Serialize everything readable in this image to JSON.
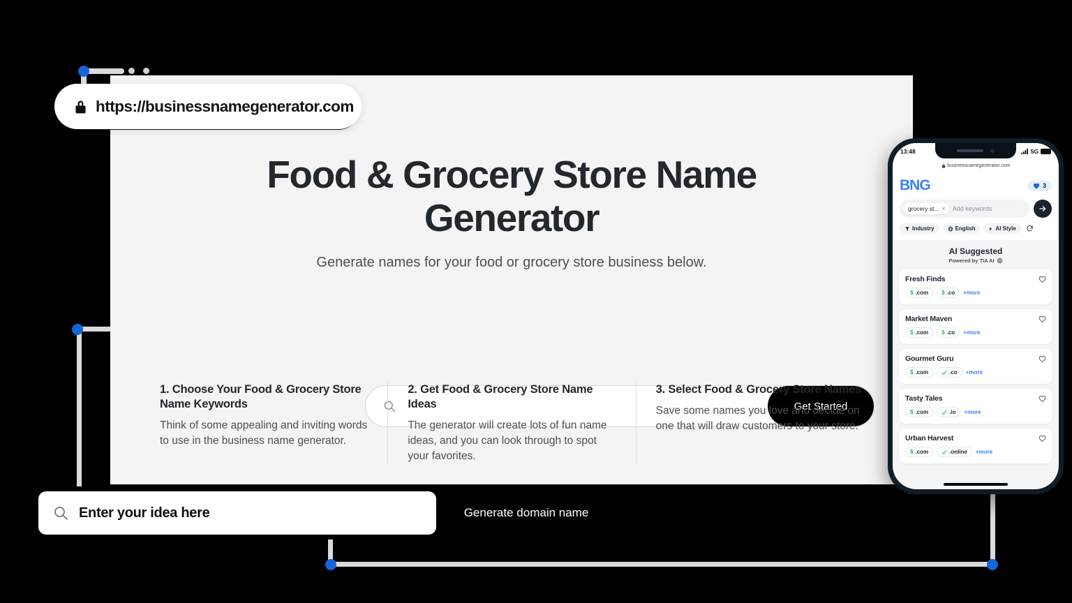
{
  "browser": {
    "url": "https://businessnamegenerator.com",
    "lock_icon": "lock-icon",
    "hero_title": "Food & Grocery Store Name Generator",
    "hero_subtitle": "Generate names for your food or grocery store business below.",
    "search": {
      "placeholder": "",
      "value": "",
      "icon": "search-icon",
      "button_label": "Get Started"
    },
    "steps": [
      {
        "title": "1. Choose Your Food & Grocery Store Name Keywords",
        "body": "Think of some appealing and inviting words to use in the business name generator."
      },
      {
        "title": "2. Get Food & Grocery Store Name Ideas",
        "body": "The generator will create lots of fun name ideas, and you can look through to spot your favorites."
      },
      {
        "title": "3. Select Food & Grocery Store Names",
        "body": "Save some names you love and decide on one that will draw customers to your store."
      }
    ]
  },
  "bottom_bar": {
    "icon": "search-icon",
    "input_value": "Enter your idea here",
    "placeholder": "Enter your idea here",
    "button_label": "Generate domain name"
  },
  "phone": {
    "status": {
      "time": "13:48",
      "network": "5G",
      "signal_icon": "signal-bars-icon",
      "battery_icon": "battery-icon"
    },
    "url_strip": {
      "lock_icon": "lock-icon",
      "domain": "businessnamegenerator.com"
    },
    "app": {
      "logo": "BNG",
      "favorites": {
        "icon": "heart-icon",
        "count": "3"
      },
      "keyword_chip": "grocery st...",
      "keyword_chip_remove": "×",
      "keyword_placeholder": "Add keywords",
      "submit_icon": "arrow-right-icon",
      "filters": [
        {
          "label": "Industry",
          "icon": "funnel-icon"
        },
        {
          "label": "English",
          "icon": "globe-icon"
        },
        {
          "label": "AI Style",
          "icon": "bolt-icon"
        }
      ],
      "refresh_icon": "refresh-icon",
      "suggested_title": "AI Suggested",
      "suggested_subtitle": "Powered by TIA AI",
      "suggested_subtitle_icon": "chip-icon",
      "results": [
        {
          "name": "Fresh Finds",
          "tlds": [
            {
              "label": ".com",
              "state": "paid"
            },
            {
              "label": ".co",
              "state": "paid"
            }
          ],
          "more": "+more",
          "fav_icon": "heart-outline-icon"
        },
        {
          "name": "Market Maven",
          "tlds": [
            {
              "label": ".com",
              "state": "paid"
            },
            {
              "label": ".co",
              "state": "paid"
            }
          ],
          "more": "+more",
          "fav_icon": "heart-outline-icon"
        },
        {
          "name": "Gourmet Guru",
          "tlds": [
            {
              "label": ".com",
              "state": "paid"
            },
            {
              "label": ".co",
              "state": "available"
            }
          ],
          "more": "+more",
          "fav_icon": "heart-outline-icon"
        },
        {
          "name": "Tasty Tales",
          "tlds": [
            {
              "label": ".com",
              "state": "paid"
            },
            {
              "label": ".io",
              "state": "available"
            }
          ],
          "more": "+more",
          "fav_icon": "heart-outline-icon"
        },
        {
          "name": "Urban Harvest",
          "tlds": [
            {
              "label": ".com",
              "state": "paid"
            },
            {
              "label": ".online",
              "state": "available"
            }
          ],
          "more": "+more",
          "fav_icon": "heart-outline-icon"
        }
      ]
    }
  },
  "colors": {
    "accent_blue": "#1565d8",
    "brand_blue": "#3c82f6",
    "available_green": "#22c55e",
    "page_bg": "#f3f4f3",
    "dark": "#000000"
  }
}
